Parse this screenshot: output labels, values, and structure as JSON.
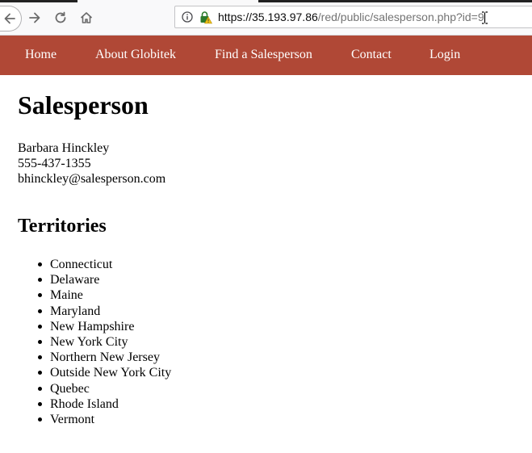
{
  "browser": {
    "url_host": "https://35.193.97.86",
    "url_path": "/red/public/salesperson.php?id=9"
  },
  "site_nav": {
    "items": [
      "Home",
      "About Globitek",
      "Find a Salesperson",
      "Contact",
      "Login"
    ]
  },
  "page": {
    "title": "Salesperson",
    "name": "Barbara Hinckley",
    "phone": "555-437-1355",
    "email": "bhinckley@salesperson.com",
    "territories_heading": "Territories",
    "territories": [
      "Connecticut",
      "Delaware",
      "Maine",
      "Maryland",
      "New Hampshire",
      "New York City",
      "Northern New Jersey",
      "Outside New York City",
      "Quebec",
      "Rhode Island",
      "Vermont"
    ]
  }
}
